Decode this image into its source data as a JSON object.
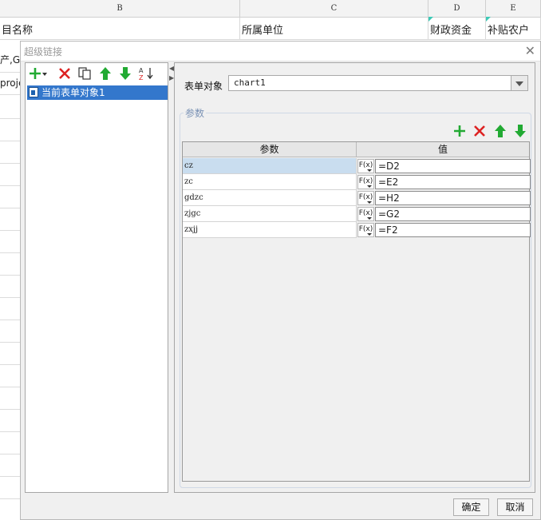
{
  "sheet": {
    "columns": [
      {
        "label": "B"
      },
      {
        "label": "C"
      },
      {
        "label": "D"
      },
      {
        "label": "E"
      }
    ],
    "header_cells": [
      "目名称",
      "所属单位",
      "财政资金",
      "补贴农户"
    ],
    "left_cells": [
      "产,G(",
      "proje"
    ]
  },
  "dialog": {
    "title": "超级链接",
    "close_glyph": "✕",
    "tree_item": "当前表单对象1",
    "object_label": "表单对象",
    "object_value": "chart1",
    "group_title": "参数",
    "table": {
      "headers": [
        "参数",
        "值"
      ],
      "rows": [
        {
          "name": "cz",
          "fx": "F(x)",
          "value": "=D2"
        },
        {
          "name": "zc",
          "fx": "F(x)",
          "value": "=E2"
        },
        {
          "name": "gdzc",
          "fx": "F(x)",
          "value": "=H2"
        },
        {
          "name": "zjgc",
          "fx": "F(x)",
          "value": "=G2"
        },
        {
          "name": "zxjj",
          "fx": "F(x)",
          "value": "=F2"
        }
      ]
    },
    "ok_label": "确定",
    "cancel_label": "取消"
  },
  "colors": {
    "add": "#22aa33",
    "delete": "#dd2222",
    "arrow": "#22aa33",
    "selection": "#3377cc"
  }
}
